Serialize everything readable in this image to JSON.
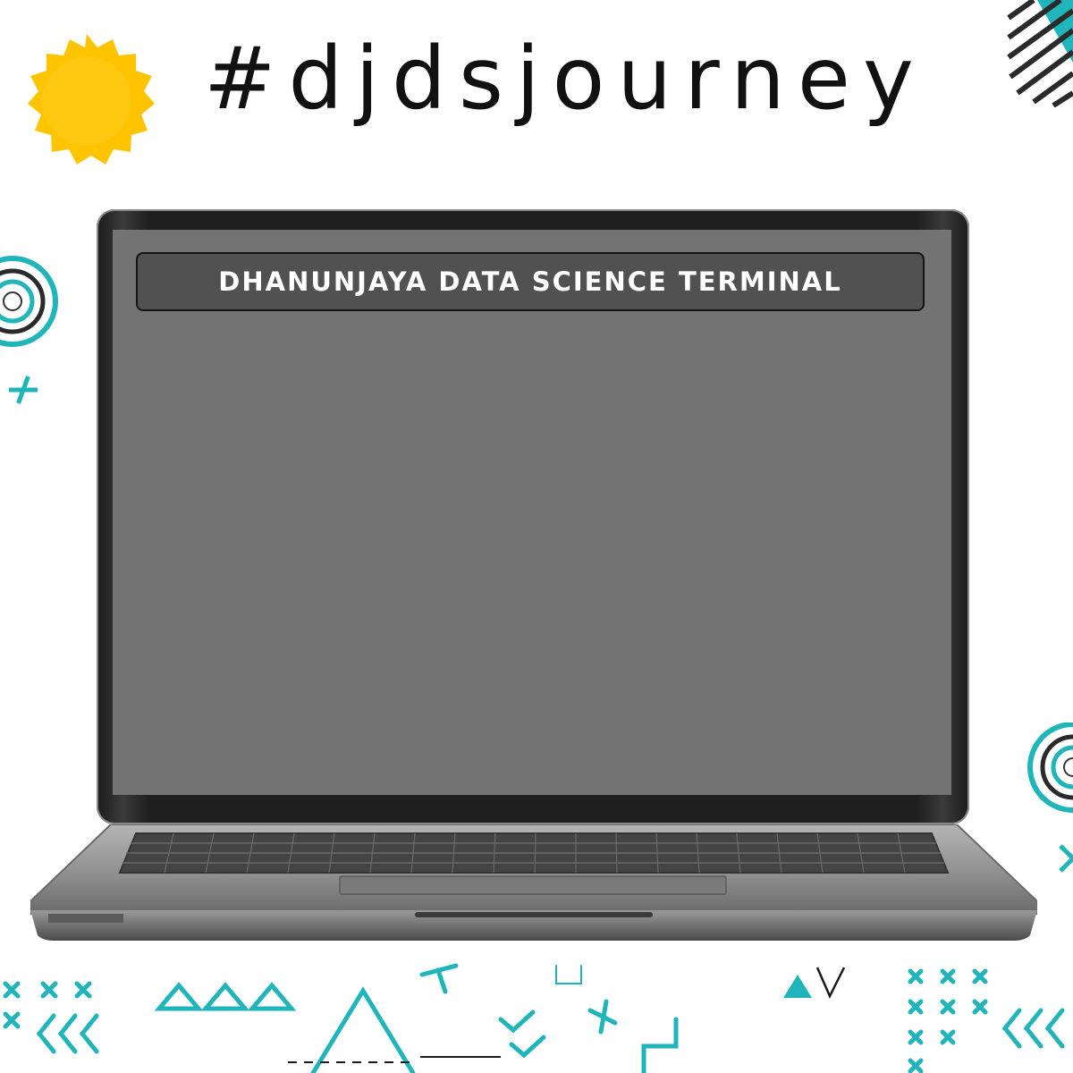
{
  "header": {
    "hashtag": "#djdsjourney"
  },
  "screen": {
    "title": "DHANUNJAYA DATA SCIENCE TERMINAL",
    "background": "#737373"
  },
  "colors": {
    "accent": "#1fb5ba",
    "sun": "#ffc400",
    "dark": "#1a1a1a"
  },
  "decorations": {
    "sun": "yellow-badge-icon",
    "target": "concentric-circles-icon",
    "cross": "cross-icon",
    "triangle": "triangle-icon",
    "chevrons": "chevron-left-icon",
    "stripes": "diagonal-stripes-icon"
  }
}
